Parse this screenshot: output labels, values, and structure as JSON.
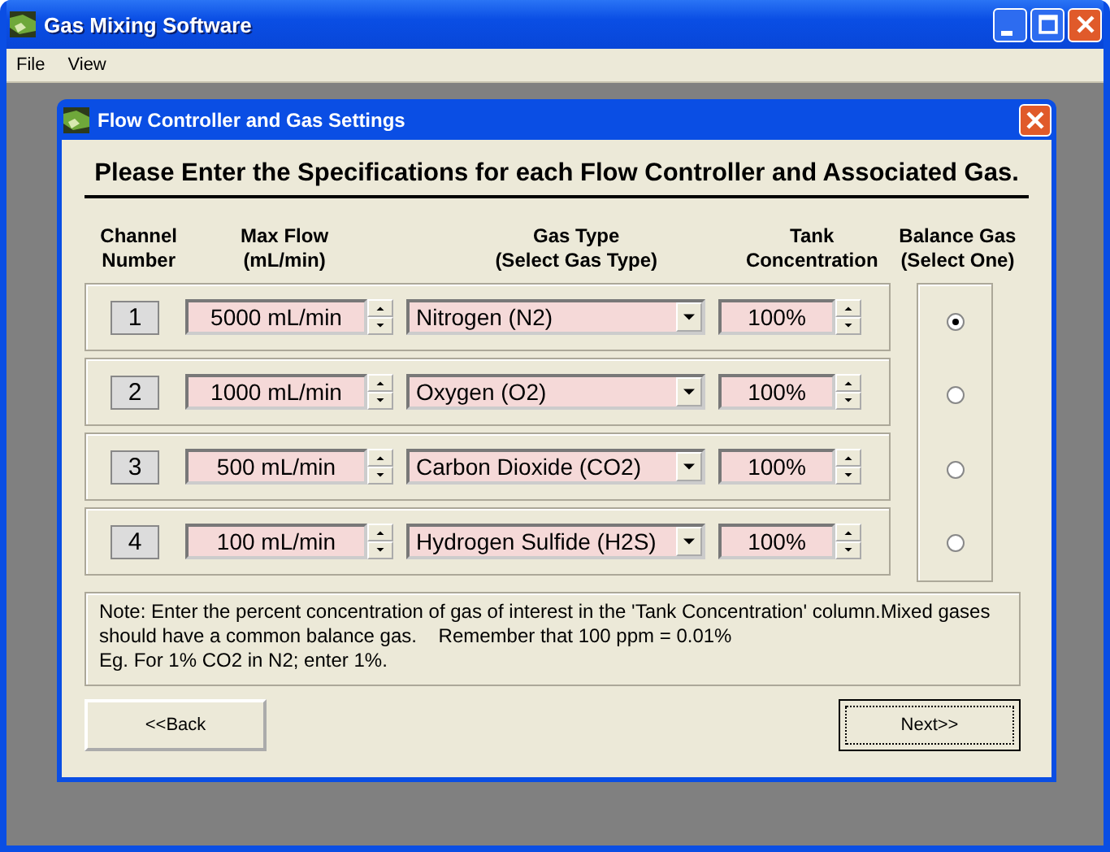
{
  "window": {
    "title": "Gas Mixing Software"
  },
  "menu": [
    "File",
    "View"
  ],
  "dialog": {
    "title": "Flow Controller and Gas Settings",
    "heading": "Please Enter the Specifications for each Flow Controller and Associated Gas."
  },
  "columns": [
    "Channel\nNumber",
    "Max Flow\n(mL/min)",
    "Gas Type\n(Select Gas Type)",
    "Tank\nConcentration",
    "Balance Gas\n(Select One)"
  ],
  "channels": [
    {
      "number": "1",
      "max_flow": "5000 mL/min",
      "gas_type": "Nitrogen (N2)",
      "concentration": "100%",
      "selected": true
    },
    {
      "number": "2",
      "max_flow": "1000 mL/min",
      "gas_type": "Oxygen (O2)",
      "concentration": "100%",
      "selected": false
    },
    {
      "number": "3",
      "max_flow": "500 mL/min",
      "gas_type": "Carbon Dioxide (CO2)",
      "concentration": "100%",
      "selected": false
    },
    {
      "number": "4",
      "max_flow": "100 mL/min",
      "gas_type": "Hydrogen Sulfide (H2S)",
      "concentration": "100%",
      "selected": false
    }
  ],
  "note": "Note: Enter the percent concentration of gas of interest in the 'Tank Concentration' column.Mixed gases should have a common balance gas.    Remember that 100 ppm = 0.01%\nEg. For 1% CO2 in N2; enter 1%.",
  "buttons": {
    "back": "<<Back",
    "next": "Next>>"
  }
}
